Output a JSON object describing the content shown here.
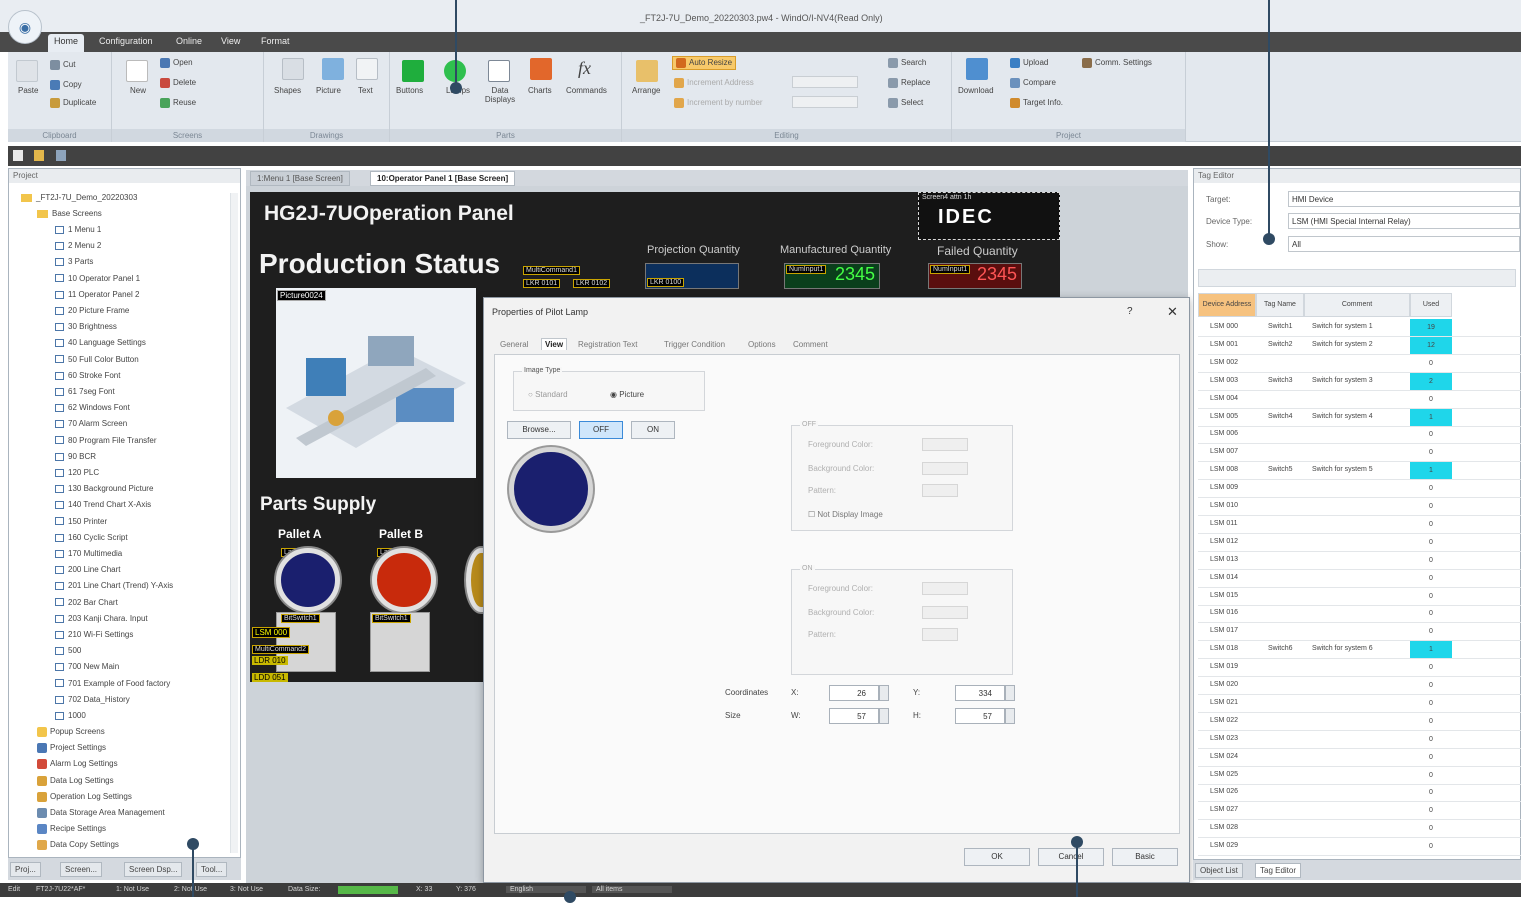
{
  "window": {
    "title": "_FT2J-7U_Demo_20220303.pw4 - WindO/I-NV4(Read Only)"
  },
  "menu": {
    "tabs": [
      "Home",
      "Configuration",
      "Online",
      "View",
      "Format"
    ],
    "active": "Home"
  },
  "ribbon": {
    "clipboard": {
      "label": "Clipboard",
      "paste": "Paste",
      "cut": "Cut",
      "copy": "Copy",
      "duplicate": "Duplicate"
    },
    "screens": {
      "label": "Screens",
      "new": "New",
      "open": "Open",
      "delete": "Delete",
      "reuse": "Reuse"
    },
    "drawings": {
      "label": "Drawings",
      "shapes": "Shapes",
      "picture": "Picture",
      "text": "Text"
    },
    "parts": {
      "label": "Parts",
      "buttons": "Buttons",
      "lamps": "Lamps",
      "data_displays": "Data Displays",
      "charts": "Charts",
      "commands": "Commands"
    },
    "editing": {
      "label": "Editing",
      "arrange": "Arrange",
      "auto_resize": "Auto Resize",
      "increment_address": "Increment Address",
      "increment_by_number": "Increment by number",
      "search": "Search",
      "replace": "Replace",
      "select": "Select"
    },
    "project": {
      "label": "Project",
      "download": "Download",
      "upload": "Upload",
      "compare": "Compare",
      "target_info": "Target Info.",
      "comm_settings": "Comm. Settings"
    }
  },
  "project_panel": {
    "header": "Project",
    "root": "_FT2J-7U_Demo_20220303",
    "base_screens": "Base Screens",
    "screens": [
      "1 Menu 1",
      "2 Menu 2",
      "3 Parts",
      "10 Operator Panel 1",
      "11 Operator Panel 2",
      "20 Picture Frame",
      "30 Brightness",
      "40 Language Settings",
      "50 Full Color Button",
      "60 Stroke Font",
      "61 7seg Font",
      "62 Windows Font",
      "70 Alarm Screen",
      "80 Program File Transfer",
      "90 BCR",
      "120 PLC",
      "130 Background Picture",
      "140 Trend Chart X-Axis",
      "150 Printer",
      "160 Cyclic Script",
      "170 Multimedia",
      "200 Line Chart",
      "201 Line Chart (Trend) Y-Axis",
      "202 Bar Chart",
      "203 Kanji Chara. Input",
      "210 Wi-Fi Settings",
      "500",
      "700 New Main",
      "701 Example of Food factory",
      "702 Data_History",
      "1000"
    ],
    "others": [
      "Popup Screens",
      "Project Settings",
      "Alarm Log Settings",
      "Data Log Settings",
      "Operation Log Settings",
      "Data Storage Area Management",
      "Recipe Settings",
      "Data Copy Settings"
    ],
    "tabs": [
      "Proj...",
      "Screen...",
      "Screen Dsp...",
      "Tool..."
    ]
  },
  "doc_tabs": [
    "1:Menu 1 [Base Screen]",
    "10:Operator Panel 1 [Base Screen]"
  ],
  "hmi": {
    "title": "HG2J-7UOperation Panel",
    "logo": "IDEC",
    "logo_caption": "Screen4 attn 1h",
    "production_status": "Production Status",
    "projection_quantity": "Projection Quantity",
    "manufactured_quantity": "Manufactured Quantity",
    "failed_quantity": "Failed Quantity",
    "numinput_label": "NumInput1",
    "manufactured_value": "2345",
    "failed_value": "2345",
    "multicommand": "MultiCommand1",
    "multicommand2": "MultiCommand2",
    "lkr_0101": "LKR 0101",
    "lkr_0102": "LKR 0102",
    "lkr_0100": "LKR 0100",
    "picture_id": "Picture0024",
    "parts_supply": "Parts Supply",
    "pallet_a": "Pallet A",
    "pallet_b": "Pallet B",
    "lamp1": "Lamp1",
    "lamp2": "Lamp2",
    "bitswitch": "BitSwitch1",
    "lsm": "LSM 000",
    "ldr": "LDR 010",
    "ldd": "LDD 051"
  },
  "dialog": {
    "title": "Properties of Pilot Lamp",
    "help": "?",
    "close": "✕",
    "tabs": [
      "General",
      "View",
      "Registration Text",
      "Trigger Condition",
      "Options",
      "Comment"
    ],
    "active_tab": "View",
    "image_type": "Image Type",
    "standard": "Standard",
    "picture": "Picture",
    "browse": "Browse...",
    "off": "OFF",
    "on": "ON",
    "off_section": "OFF",
    "on_section": "ON",
    "foreground_color": "Foreground Color:",
    "background_color": "Background Color:",
    "pattern": "Pattern:",
    "not_display_image": "Not Display Image",
    "coordinates": "Coordinates",
    "size": "Size",
    "x_label": "X:",
    "y_label": "Y:",
    "w_label": "W:",
    "h_label": "H:",
    "x": "26",
    "y": "334",
    "w": "57",
    "h": "57",
    "ok": "OK",
    "cancel": "Cancel",
    "basic": "Basic",
    "lamp_color": "#1a1f6e"
  },
  "tag_editor": {
    "header": "Tag Editor",
    "target_label": "Target:",
    "target_value": "HMI Device",
    "device_type_label": "Device Type:",
    "device_type_value": "LSM (HMI Special Internal Relay)",
    "show_label": "Show:",
    "show_value": "All",
    "columns": [
      "Device Address",
      "Tag Name",
      "Comment",
      "Used"
    ],
    "rows": [
      {
        "addr": "LSM 000",
        "tag": "Switch1",
        "comment": "Switch for system 1",
        "used": "19",
        "hl": true
      },
      {
        "addr": "LSM 001",
        "tag": "Switch2",
        "comment": "Switch for system 2",
        "used": "12",
        "hl": true
      },
      {
        "addr": "LSM 002",
        "tag": "",
        "comment": "",
        "used": "0",
        "hl": false
      },
      {
        "addr": "LSM 003",
        "tag": "Switch3",
        "comment": "Switch for system 3",
        "used": "2",
        "hl": true
      },
      {
        "addr": "LSM 004",
        "tag": "",
        "comment": "",
        "used": "0",
        "hl": false
      },
      {
        "addr": "LSM 005",
        "tag": "Switch4",
        "comment": "Switch for system 4",
        "used": "1",
        "hl": true
      },
      {
        "addr": "LSM 006",
        "tag": "",
        "comment": "",
        "used": "0",
        "hl": false
      },
      {
        "addr": "LSM 007",
        "tag": "",
        "comment": "",
        "used": "0",
        "hl": false
      },
      {
        "addr": "LSM 008",
        "tag": "Switch5",
        "comment": "Switch for system 5",
        "used": "1",
        "hl": true
      },
      {
        "addr": "LSM 009",
        "tag": "",
        "comment": "",
        "used": "0",
        "hl": false
      },
      {
        "addr": "LSM 010",
        "tag": "",
        "comment": "",
        "used": "0",
        "hl": false
      },
      {
        "addr": "LSM 011",
        "tag": "",
        "comment": "",
        "used": "0",
        "hl": false
      },
      {
        "addr": "LSM 012",
        "tag": "",
        "comment": "",
        "used": "0",
        "hl": false
      },
      {
        "addr": "LSM 013",
        "tag": "",
        "comment": "",
        "used": "0",
        "hl": false
      },
      {
        "addr": "LSM 014",
        "tag": "",
        "comment": "",
        "used": "0",
        "hl": false
      },
      {
        "addr": "LSM 015",
        "tag": "",
        "comment": "",
        "used": "0",
        "hl": false
      },
      {
        "addr": "LSM 016",
        "tag": "",
        "comment": "",
        "used": "0",
        "hl": false
      },
      {
        "addr": "LSM 017",
        "tag": "",
        "comment": "",
        "used": "0",
        "hl": false
      },
      {
        "addr": "LSM 018",
        "tag": "Switch6",
        "comment": "Switch for system 6",
        "used": "1",
        "hl": true
      },
      {
        "addr": "LSM 019",
        "tag": "",
        "comment": "",
        "used": "0",
        "hl": false
      },
      {
        "addr": "LSM 020",
        "tag": "",
        "comment": "",
        "used": "0",
        "hl": false
      },
      {
        "addr": "LSM 021",
        "tag": "",
        "comment": "",
        "used": "0",
        "hl": false
      },
      {
        "addr": "LSM 022",
        "tag": "",
        "comment": "",
        "used": "0",
        "hl": false
      },
      {
        "addr": "LSM 023",
        "tag": "",
        "comment": "",
        "used": "0",
        "hl": false
      },
      {
        "addr": "LSM 024",
        "tag": "",
        "comment": "",
        "used": "0",
        "hl": false
      },
      {
        "addr": "LSM 025",
        "tag": "",
        "comment": "",
        "used": "0",
        "hl": false
      },
      {
        "addr": "LSM 026",
        "tag": "",
        "comment": "",
        "used": "0",
        "hl": false
      },
      {
        "addr": "LSM 027",
        "tag": "",
        "comment": "",
        "used": "0",
        "hl": false
      },
      {
        "addr": "LSM 028",
        "tag": "",
        "comment": "",
        "used": "0",
        "hl": false
      },
      {
        "addr": "LSM 029",
        "tag": "",
        "comment": "",
        "used": "0",
        "hl": false
      }
    ],
    "tabs": [
      "Object List",
      "Tag Editor"
    ]
  },
  "statusbar": {
    "mode": "Edit",
    "model": "FT2J-7U22*AF*",
    "not_use1": "1: Not Use",
    "not_use2": "2: Not Use",
    "not_use3": "3: Not Use",
    "data_size": "Data Size:",
    "x": "X: 33",
    "y": "Y: 376",
    "language": "English",
    "all_items": "All items"
  },
  "colors": {
    "accent": "#2f4a63",
    "highlight": "#1fd6ea",
    "lamp_blue": "#1a1f6e",
    "lamp_red": "#c82a0c"
  }
}
